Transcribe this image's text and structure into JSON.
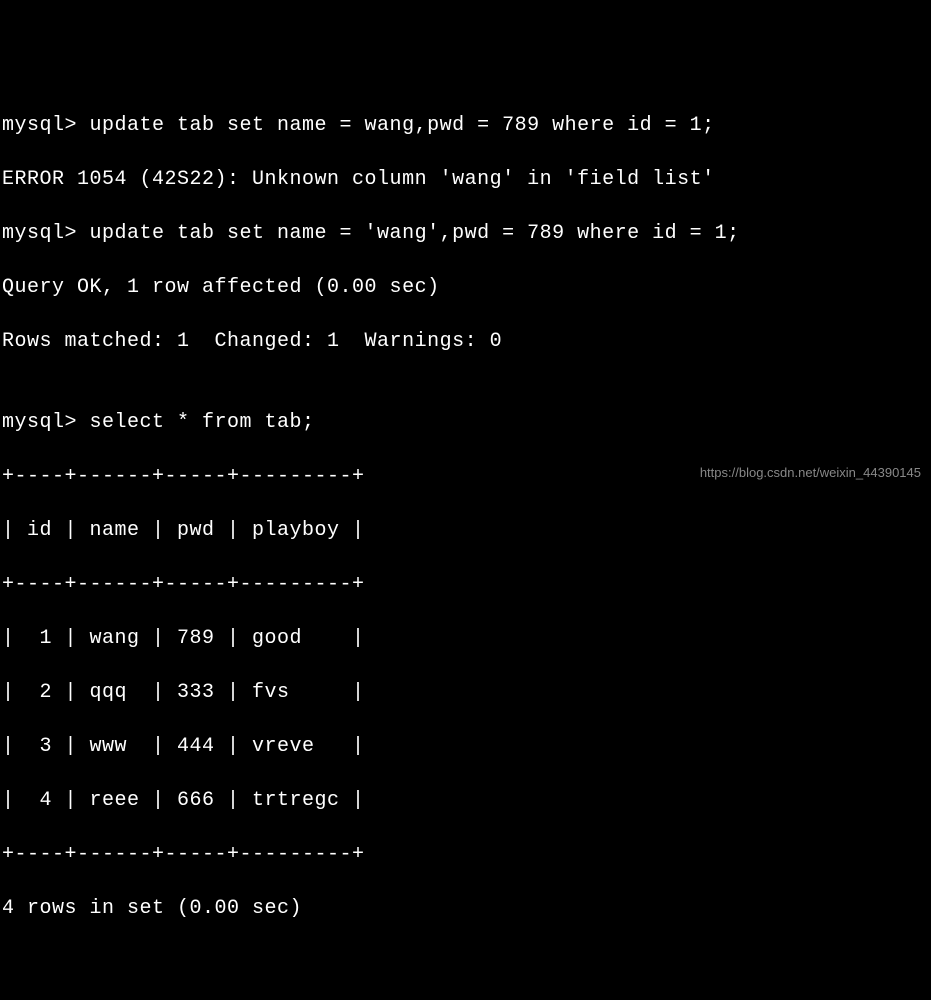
{
  "lines": {
    "l1": "mysql> update tab set name = wang,pwd = 789 where id = 1;",
    "l2": "ERROR 1054 (42S22): Unknown column 'wang' in 'field list'",
    "l3": "mysql> update tab set name = 'wang',pwd = 789 where id = 1;",
    "l4": "Query OK, 1 row affected (0.00 sec)",
    "l5": "Rows matched: 1  Changed: 1  Warnings: 0",
    "l6": "",
    "l7": "mysql> select * from tab;",
    "l8": "+----+------+-----+---------+",
    "l9": "| id | name | pwd | playboy |",
    "l10": "+----+------+-----+---------+",
    "l11": "|  1 | wang | 789 | good    |",
    "l12": "|  2 | qqq  | 333 | fvs     |",
    "l13": "|  3 | www  | 444 | vreve   |",
    "l14": "|  4 | reee | 666 | trtregc |",
    "l15": "+----+------+-----+---------+",
    "l16": "4 rows in set (0.00 sec)"
  },
  "watermark": "https://blog.csdn.net/weixin_44390145",
  "chart_data": {
    "type": "table",
    "columns": [
      "id",
      "name",
      "pwd",
      "playboy"
    ],
    "rows": [
      {
        "id": 1,
        "name": "wang",
        "pwd": 789,
        "playboy": "good"
      },
      {
        "id": 2,
        "name": "qqq",
        "pwd": 333,
        "playboy": "fvs"
      },
      {
        "id": 3,
        "name": "www",
        "pwd": 444,
        "playboy": "vreve"
      },
      {
        "id": 4,
        "name": "reee",
        "pwd": 666,
        "playboy": "trtregc"
      }
    ],
    "queries": [
      {
        "sql": "update tab set name = wang,pwd = 789 where id = 1;",
        "result": "ERROR 1054 (42S22): Unknown column 'wang' in 'field list'"
      },
      {
        "sql": "update tab set name = 'wang',pwd = 789 where id = 1;",
        "result": "Query OK, 1 row affected (0.00 sec)",
        "rows_matched": 1,
        "changed": 1,
        "warnings": 0
      },
      {
        "sql": "select * from tab;",
        "result": "4 rows in set (0.00 sec)"
      }
    ]
  }
}
